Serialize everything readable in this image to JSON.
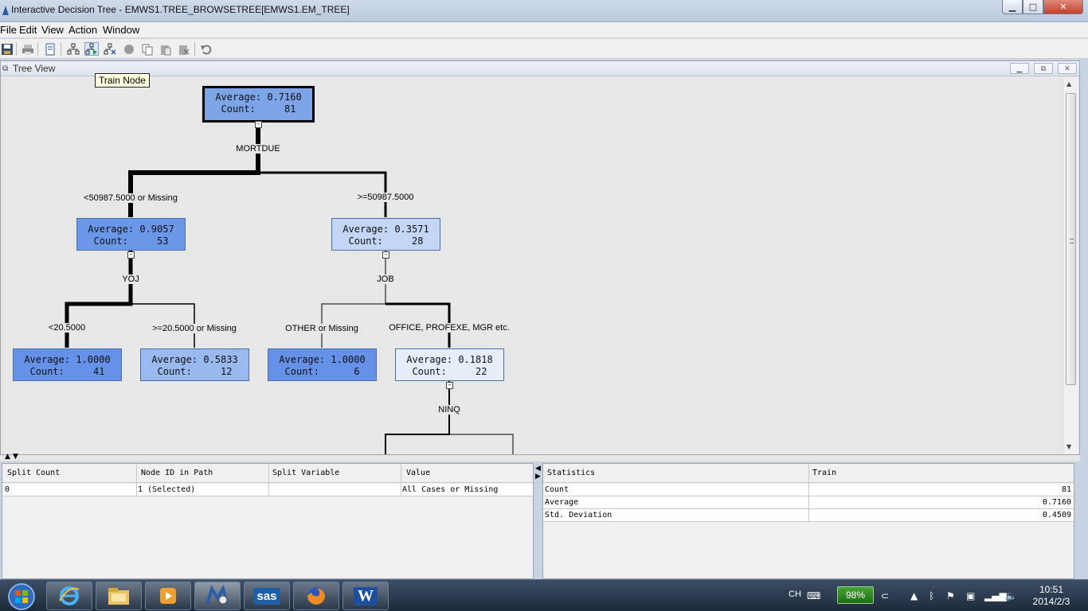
{
  "window": {
    "title": "Interactive Decision Tree - EMWS1.TREE_BROWSETREE[EMWS1.EM_TREE]",
    "min_glyph": "▁",
    "max_glyph": "□",
    "close_glyph": "✕"
  },
  "menu": [
    "File",
    "Edit",
    "View",
    "Action",
    "Window"
  ],
  "toolbar": {
    "tooltip": "Train Node",
    "buttons": [
      "save-icon",
      "print-icon",
      "document-icon",
      "tree-icon",
      "train-node-icon",
      "prune-icon",
      "record-icon",
      "copy-icon",
      "paste-icon",
      "clipboard-icon",
      "undo-icon"
    ]
  },
  "tree_view": {
    "title": "Tree View",
    "nodes": [
      {
        "id": "n1",
        "average": "Average: 0.7160",
        "count": "Count:     81",
        "fill": "#7ea4e8",
        "selected": true
      },
      {
        "id": "n2",
        "average": "Average: 0.9057",
        "count": "Count:     53",
        "fill": "#6b97e8",
        "selected": false
      },
      {
        "id": "n3",
        "average": "Average: 0.3571",
        "count": "Count:     28",
        "fill": "#c4d6f5",
        "selected": false
      },
      {
        "id": "n4",
        "average": "Average: 1.0000",
        "count": "Count:     41",
        "fill": "#6591e8",
        "selected": false
      },
      {
        "id": "n5",
        "average": "Average: 0.5833",
        "count": "Count:     12",
        "fill": "#9ab9ef",
        "selected": false
      },
      {
        "id": "n6",
        "average": "Average: 1.0000",
        "count": "Count:      6",
        "fill": "#6591e8",
        "selected": false
      },
      {
        "id": "n7",
        "average": "Average: 0.1818",
        "count": "Count:     22",
        "fill": "#e6eefb",
        "selected": false
      }
    ],
    "split_variables": [
      "MORTDUE",
      "YOJ",
      "JOB",
      "NINQ"
    ],
    "branch_labels": [
      "<50987.5000 or Missing",
      ">=50987.5000",
      "<20.5000",
      ">=20.5000 or Missing",
      "OTHER  or Missing",
      "OFFICE, PROFEXE, MGR  etc."
    ]
  },
  "path_table": {
    "columns": [
      "Split Count",
      "Node ID in Path",
      "Split Variable",
      "Value"
    ],
    "rows": [
      [
        "0",
        "1 (Selected)",
        "",
        "All Cases or Missing"
      ]
    ]
  },
  "stats_table": {
    "columns": [
      "Statistics",
      "Train"
    ],
    "rows": [
      [
        "Count",
        "81"
      ],
      [
        "Average",
        "0.7160"
      ],
      [
        "Std. Deviation",
        "0.4509"
      ]
    ]
  },
  "taskbar": {
    "apps": [
      "internet-explorer-icon",
      "file-explorer-icon",
      "media-player-icon",
      "sas-miner-icon",
      "sas-icon",
      "firefox-icon",
      "word-icon"
    ],
    "sas_label": "sas",
    "word_label": "W",
    "lang": "CH",
    "battery": "98%",
    "time": "10:51",
    "date": "2014/2/3"
  },
  "colors": {
    "accent_node": "#6591e8",
    "title_bar": "#c7d3e2",
    "taskbar": "#1d2a3b"
  }
}
